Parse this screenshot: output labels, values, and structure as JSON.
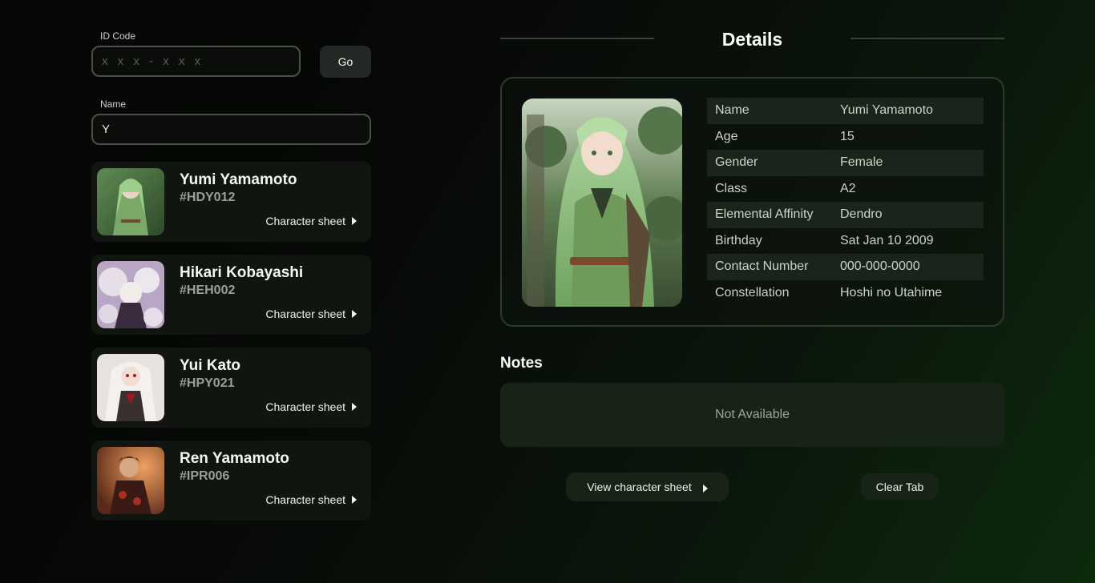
{
  "search": {
    "id_label": "ID Code",
    "id_placeholder": "x x x - x x x",
    "go_label": "Go",
    "name_label": "Name",
    "name_value": "Y"
  },
  "results": [
    {
      "name": "Yumi Yamamoto",
      "code": "#HDY012",
      "link": "Character sheet"
    },
    {
      "name": "Hikari Kobayashi",
      "code": "#HEH002",
      "link": "Character sheet"
    },
    {
      "name": "Yui Kato",
      "code": "#HPY021",
      "link": "Character sheet"
    },
    {
      "name": "Ren Yamamoto",
      "code": "#IPR006",
      "link": "Character sheet"
    }
  ],
  "details": {
    "title": "Details",
    "fields": [
      {
        "key": "Name",
        "value": "Yumi Yamamoto"
      },
      {
        "key": "Age",
        "value": "15"
      },
      {
        "key": "Gender",
        "value": "Female"
      },
      {
        "key": "Class",
        "value": "A2"
      },
      {
        "key": "Elemental Affinity",
        "value": "Dendro"
      },
      {
        "key": "Birthday",
        "value": "Sat Jan 10 2009"
      },
      {
        "key": "Contact Number",
        "value": "000-000-0000"
      },
      {
        "key": "Constellation",
        "value": "Hoshi no Utahime"
      }
    ]
  },
  "notes": {
    "title": "Notes",
    "content": "Not Available"
  },
  "actions": {
    "view_label": "View character sheet",
    "clear_label": "Clear Tab"
  },
  "colors": {
    "accent_green": "#1a241a",
    "border": "#2e3a2e"
  }
}
